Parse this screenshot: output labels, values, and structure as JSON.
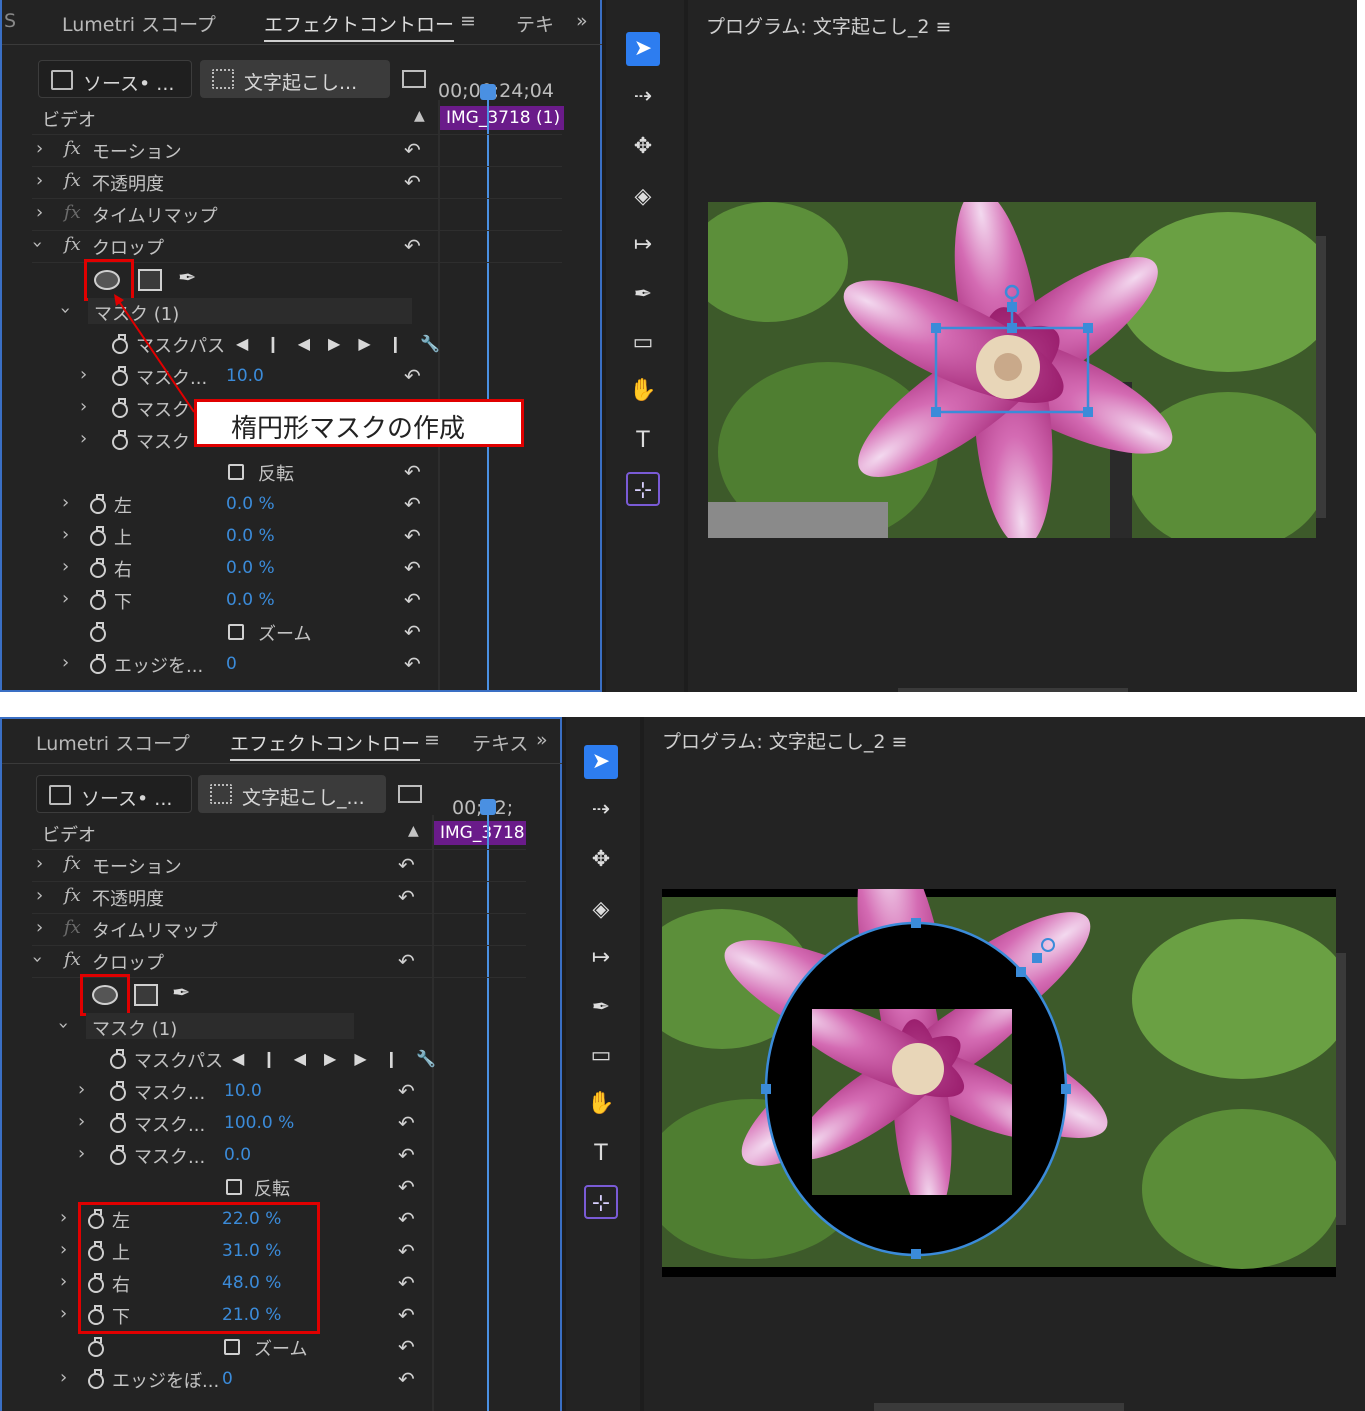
{
  "screen1": {
    "tabs": {
      "lumetri": "Lumetri スコープ",
      "effects": "エフェクトコントロー",
      "text": "テキ",
      "more": "»",
      "menu": "≡",
      "left_fragment": "S"
    },
    "source_chip": "ソース• ...",
    "sequence_chip": "文字起こし...",
    "timecode": "00;00;24;04",
    "clip_name": "IMG_3718 (1)",
    "video_label": "ビデオ",
    "effects": [
      {
        "label": "モーション",
        "expanded": false
      },
      {
        "label": "不透明度",
        "expanded": false
      },
      {
        "label": "タイムリマップ",
        "expanded": false,
        "dim": true
      },
      {
        "label": "クロップ",
        "expanded": true
      }
    ],
    "mask_label": "マスク (1)",
    "mask_path_label": "マスクパス",
    "mask_rows": [
      {
        "label": "マスク...",
        "value": "10.0"
      },
      {
        "label": "マスク",
        "value": ""
      },
      {
        "label": "マスク",
        "value": ""
      }
    ],
    "invert_label": "反転",
    "crop_rows": [
      {
        "label": "左",
        "value": "0.0 %"
      },
      {
        "label": "上",
        "value": "0.0 %"
      },
      {
        "label": "右",
        "value": "0.0 %"
      },
      {
        "label": "下",
        "value": "0.0 %"
      }
    ],
    "zoom_label": "ズーム",
    "edge_label": "エッジを...",
    "edge_value": "0",
    "program_title": "プログラム: 文字起こし_2",
    "callout": "楕円形マスクの作成"
  },
  "screen2": {
    "tabs": {
      "lumetri": "Lumetri スコープ",
      "effects": "エフェクトコントロー",
      "text": "テキス",
      "more": "»",
      "menu": "≡"
    },
    "source_chip": "ソース• ...",
    "sequence_chip": "文字起こし_...",
    "timecode": "00;02;",
    "clip_name": "IMG_3718",
    "video_label": "ビデオ",
    "effects": [
      {
        "label": "モーション",
        "expanded": false
      },
      {
        "label": "不透明度",
        "expanded": false
      },
      {
        "label": "タイムリマップ",
        "expanded": false,
        "dim": true
      },
      {
        "label": "クロップ",
        "expanded": true
      }
    ],
    "mask_label": "マスク (1)",
    "mask_path_label": "マスクパス",
    "mask_rows": [
      {
        "label": "マスク...",
        "value": "10.0"
      },
      {
        "label": "マスク...",
        "value": "100.0 %"
      },
      {
        "label": "マスク...",
        "value": "0.0"
      }
    ],
    "invert_label": "反転",
    "crop_rows": [
      {
        "label": "左",
        "value": "22.0 %"
      },
      {
        "label": "上",
        "value": "31.0 %"
      },
      {
        "label": "右",
        "value": "48.0 %"
      },
      {
        "label": "下",
        "value": "21.0 %"
      }
    ],
    "zoom_label": "ズーム",
    "edge_label": "エッジをぼ...",
    "edge_value": "0",
    "program_title": "プログラム: 文字起こし_2"
  },
  "tools": [
    "selection-icon",
    "track-select-icon",
    "ripple-edit-icon",
    "razor-icon",
    "slip-icon",
    "pen-icon",
    "rectangle-icon",
    "hand-icon",
    "type-icon",
    "auto-reframe-icon"
  ],
  "tool_glyphs": [
    "➤",
    "⇢",
    "✥",
    "◈",
    "↦",
    "✒",
    "▭",
    "✋",
    "T",
    "⊹"
  ],
  "colors": {
    "accent": "#2d7df0",
    "value_blue": "#3b8bd9",
    "highlight_red": "#e00000",
    "clip_purple": "#6a1b8a"
  }
}
